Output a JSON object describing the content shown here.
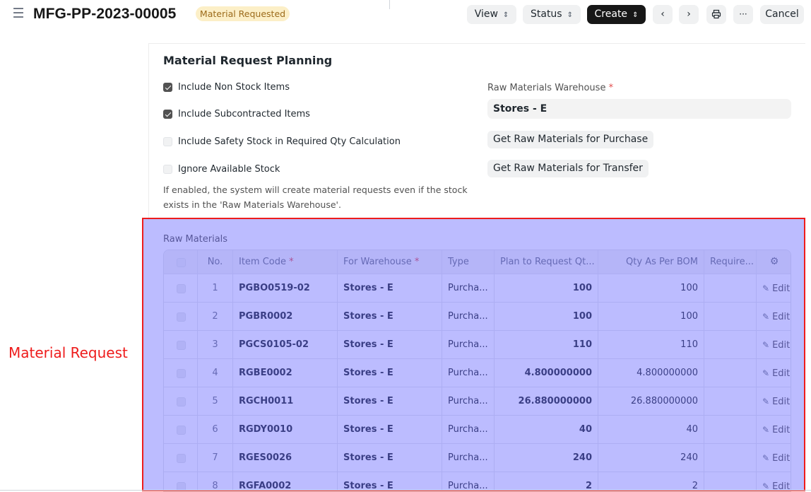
{
  "header": {
    "title": "MFG-PP-2023-00005",
    "status": "Material Requested",
    "buttons": {
      "view": "View",
      "status": "Status",
      "create": "Create",
      "cancel": "Cancel"
    },
    "icons": [
      "menu-icon",
      "chevron-left-icon",
      "chevron-right-icon",
      "print-icon",
      "more-icon"
    ]
  },
  "section": {
    "title": "Material Request Planning",
    "checkboxes": [
      {
        "label": "Include Non Stock Items",
        "checked": true
      },
      {
        "label": "Include Subcontracted Items",
        "checked": true
      },
      {
        "label": "Include Safety Stock in Required Qty Calculation",
        "checked": false
      },
      {
        "label": "Ignore Available Stock",
        "checked": false
      }
    ],
    "help_text": "If enabled, the system will create material requests even if the stock exists in the 'Raw Materials Warehouse'.",
    "warehouse_label": "Raw Materials Warehouse",
    "warehouse_required": "*",
    "warehouse_value": "Stores - E",
    "btn_purchase": "Get Raw Materials for Purchase",
    "btn_transfer": "Get Raw Materials for Transfer"
  },
  "grid": {
    "label": "Raw Materials",
    "columns": {
      "no": "No.",
      "item_code": "Item Code",
      "warehouse": "For Warehouse",
      "type": "Type",
      "plan_qty": "Plan to Request Qt...",
      "bom_qty": "Qty As Per BOM",
      "required": "Require..."
    },
    "required_mark": "*",
    "edit_label": "Edit",
    "rows": [
      {
        "no": "1",
        "item": "PGBO0519-02",
        "warehouse": "Stores - E",
        "type": "Purcha...",
        "plan": "100",
        "bom": "100"
      },
      {
        "no": "2",
        "item": "PGBR0002",
        "warehouse": "Stores - E",
        "type": "Purcha...",
        "plan": "100",
        "bom": "100"
      },
      {
        "no": "3",
        "item": "PGCS0105-02",
        "warehouse": "Stores - E",
        "type": "Purcha...",
        "plan": "110",
        "bom": "110"
      },
      {
        "no": "4",
        "item": "RGBE0002",
        "warehouse": "Stores - E",
        "type": "Purcha...",
        "plan": "4.800000000",
        "bom": "4.800000000"
      },
      {
        "no": "5",
        "item": "RGCH0011",
        "warehouse": "Stores - E",
        "type": "Purcha...",
        "plan": "26.880000000",
        "bom": "26.880000000"
      },
      {
        "no": "6",
        "item": "RGDY0010",
        "warehouse": "Stores - E",
        "type": "Purcha...",
        "plan": "40",
        "bom": "40"
      },
      {
        "no": "7",
        "item": "RGES0026",
        "warehouse": "Stores - E",
        "type": "Purcha...",
        "plan": "240",
        "bom": "240"
      },
      {
        "no": "8",
        "item": "RGFA0002",
        "warehouse": "Stores - E",
        "type": "Purcha...",
        "plan": "2",
        "bom": "2"
      }
    ]
  },
  "annotation": {
    "label": "Material Request",
    "colors": {
      "outline": "#ee1c1c",
      "fill": "#6060ff"
    }
  }
}
